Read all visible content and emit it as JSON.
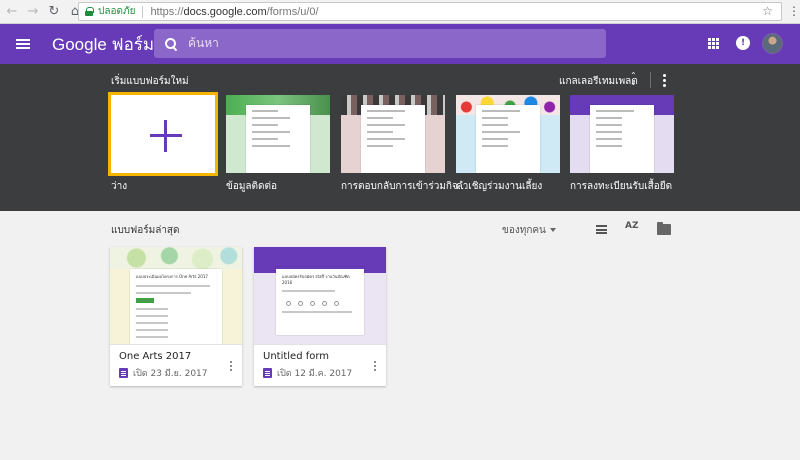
{
  "browser": {
    "back_icon": "back-arrow-icon",
    "forward_icon": "forward-arrow-icon",
    "reload_icon": "reload-icon",
    "home_icon": "home-icon",
    "back_glyph": "←",
    "forward_glyph": "→",
    "reload_glyph": "↻",
    "home_glyph": "⌂",
    "secure_label": "ปลอดภัย",
    "url_prefix": "https://",
    "url_host": "docs.google.com",
    "url_path": "/forms/u/0/",
    "star_glyph": "☆",
    "menu_glyph": "⋮"
  },
  "appbar": {
    "title": "Google ฟอร์ม",
    "search_placeholder": "ค้นหา",
    "notifications_glyph": "!",
    "color": "#673ab7"
  },
  "gallery": {
    "title": "เริ่มแบบฟอร์มใหม่",
    "gallery_link": "แกลเลอรีเทมเพลต",
    "updown_glyph": "⌃⌄",
    "templates": [
      {
        "label": "ว่าง",
        "thumb": "blank"
      },
      {
        "label": "ข้อมูลติดต่อ",
        "thumb": "contact-info"
      },
      {
        "label": "การตอบกลับการเข้าร่วมกิจ...",
        "thumb": "event-rsvp"
      },
      {
        "label": "คำเชิญร่วมงานเลี้ยง",
        "thumb": "party-invite"
      },
      {
        "label": "การลงทะเบียนรับเสื้อยืด",
        "thumb": "tshirt-signup"
      }
    ],
    "accent": "#f4b400"
  },
  "recent": {
    "title": "แบบฟอร์มล่าสุด",
    "owner_filter": "ของทุกคน",
    "sort_glyph": "AZ",
    "forms": [
      {
        "name": "One Arts 2017",
        "opened": "เปิด 23 มี.ย. 2017",
        "thumb_title": "แบบประเมินผลโครงการ One Arts 2017"
      },
      {
        "name": "Untitled form",
        "opened": "เปิด 12 มี.ค. 2017",
        "thumb_title": "แบบสมัครรับสมัคร staff งานวันบัณฑิต 2016"
      }
    ]
  }
}
